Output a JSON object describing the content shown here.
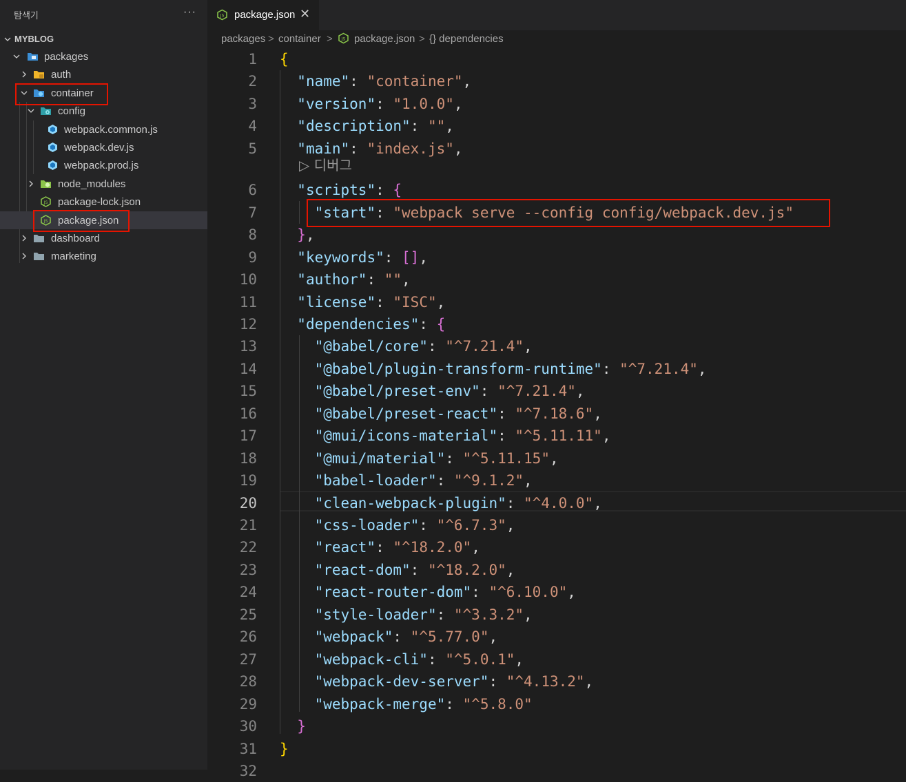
{
  "sidebar": {
    "title": "탐색기",
    "more_label": "···",
    "root_label": "MYBLOG",
    "items": [
      {
        "label": "packages"
      },
      {
        "label": "auth"
      },
      {
        "label": "container"
      },
      {
        "label": "config"
      },
      {
        "label": "webpack.common.js"
      },
      {
        "label": "webpack.dev.js"
      },
      {
        "label": "webpack.prod.js"
      },
      {
        "label": "node_modules"
      },
      {
        "label": "package-lock.json"
      },
      {
        "label": "package.json"
      },
      {
        "label": "dashboard"
      },
      {
        "label": "marketing"
      }
    ]
  },
  "tab": {
    "label": "package.json",
    "close_label": "✕"
  },
  "breadcrumb": {
    "items": [
      "packages",
      "container",
      "package.json",
      "{} dependencies"
    ],
    "separator": ">"
  },
  "editor": {
    "codelens_label": "▷ 디버그",
    "current_line": 20,
    "line_numbers": [
      "1",
      "2",
      "3",
      "4",
      "5",
      "6",
      "7",
      "8",
      "9",
      "10",
      "11",
      "12",
      "13",
      "14",
      "15",
      "16",
      "17",
      "18",
      "19",
      "20",
      "21",
      "22",
      "23",
      "24",
      "25",
      "26",
      "27",
      "28",
      "29",
      "30",
      "31",
      "32"
    ],
    "lines": [
      {
        "indent": "",
        "key": "",
        "value": "",
        "open": "{",
        "close": "",
        "tail": ""
      },
      {
        "indent": "  ",
        "key": "\"name\"",
        "sep": ": ",
        "value": "\"container\"",
        "tail": ","
      },
      {
        "indent": "  ",
        "key": "\"version\"",
        "sep": ": ",
        "value": "\"1.0.0\"",
        "tail": ","
      },
      {
        "indent": "  ",
        "key": "\"description\"",
        "sep": ": ",
        "value": "\"\"",
        "tail": ","
      },
      {
        "indent": "  ",
        "key": "\"main\"",
        "sep": ": ",
        "value": "\"index.js\"",
        "tail": ","
      },
      {
        "indent": "  ",
        "key": "\"scripts\"",
        "sep": ": ",
        "value": "",
        "open": "{",
        "tail": ""
      },
      {
        "indent": "    ",
        "key": "\"start\"",
        "sep": ": ",
        "value": "\"webpack serve --config config/webpack.dev.js\"",
        "tail": ""
      },
      {
        "indent": "  ",
        "key": "",
        "sep": "",
        "value": "",
        "close": "}",
        "tail": ","
      },
      {
        "indent": "  ",
        "key": "\"keywords\"",
        "sep": ": ",
        "value": "",
        "open": "[]",
        "tail": ","
      },
      {
        "indent": "  ",
        "key": "\"author\"",
        "sep": ": ",
        "value": "\"\"",
        "tail": ","
      },
      {
        "indent": "  ",
        "key": "\"license\"",
        "sep": ": ",
        "value": "\"ISC\"",
        "tail": ","
      },
      {
        "indent": "  ",
        "key": "\"dependencies\"",
        "sep": ": ",
        "value": "",
        "open": "{",
        "tail": ""
      },
      {
        "indent": "    ",
        "key": "\"@babel/core\"",
        "sep": ": ",
        "value": "\"^7.21.4\"",
        "tail": ","
      },
      {
        "indent": "    ",
        "key": "\"@babel/plugin-transform-runtime\"",
        "sep": ": ",
        "value": "\"^7.21.4\"",
        "tail": ","
      },
      {
        "indent": "    ",
        "key": "\"@babel/preset-env\"",
        "sep": ": ",
        "value": "\"^7.21.4\"",
        "tail": ","
      },
      {
        "indent": "    ",
        "key": "\"@babel/preset-react\"",
        "sep": ": ",
        "value": "\"^7.18.6\"",
        "tail": ","
      },
      {
        "indent": "    ",
        "key": "\"@mui/icons-material\"",
        "sep": ": ",
        "value": "\"^5.11.11\"",
        "tail": ","
      },
      {
        "indent": "    ",
        "key": "\"@mui/material\"",
        "sep": ": ",
        "value": "\"^5.11.15\"",
        "tail": ","
      },
      {
        "indent": "    ",
        "key": "\"babel-loader\"",
        "sep": ": ",
        "value": "\"^9.1.2\"",
        "tail": ","
      },
      {
        "indent": "    ",
        "key": "\"clean-webpack-plugin\"",
        "sep": ": ",
        "value": "\"^4.0.0\"",
        "tail": ","
      },
      {
        "indent": "    ",
        "key": "\"css-loader\"",
        "sep": ": ",
        "value": "\"^6.7.3\"",
        "tail": ","
      },
      {
        "indent": "    ",
        "key": "\"react\"",
        "sep": ": ",
        "value": "\"^18.2.0\"",
        "tail": ","
      },
      {
        "indent": "    ",
        "key": "\"react-dom\"",
        "sep": ": ",
        "value": "\"^18.2.0\"",
        "tail": ","
      },
      {
        "indent": "    ",
        "key": "\"react-router-dom\"",
        "sep": ": ",
        "value": "\"^6.10.0\"",
        "tail": ","
      },
      {
        "indent": "    ",
        "key": "\"style-loader\"",
        "sep": ": ",
        "value": "\"^3.3.2\"",
        "tail": ","
      },
      {
        "indent": "    ",
        "key": "\"webpack\"",
        "sep": ": ",
        "value": "\"^5.77.0\"",
        "tail": ","
      },
      {
        "indent": "    ",
        "key": "\"webpack-cli\"",
        "sep": ": ",
        "value": "\"^5.0.1\"",
        "tail": ","
      },
      {
        "indent": "    ",
        "key": "\"webpack-dev-server\"",
        "sep": ": ",
        "value": "\"^4.13.2\"",
        "tail": ","
      },
      {
        "indent": "    ",
        "key": "\"webpack-merge\"",
        "sep": ": ",
        "value": "\"^5.8.0\"",
        "tail": ""
      },
      {
        "indent": "  ",
        "key": "",
        "sep": "",
        "value": "",
        "close": "}",
        "tail": ""
      },
      {
        "indent": "",
        "key": "",
        "sep": "",
        "value": "",
        "close": "}",
        "tail": ""
      },
      {
        "indent": "",
        "key": "",
        "sep": "",
        "value": "",
        "tail": ""
      }
    ]
  },
  "colors": {
    "highlight_box": "#e51400",
    "json_key": "#9cdcfe",
    "json_string": "#ce9178",
    "bracket_level1": "#ffd700",
    "bracket_level2": "#da70d6"
  }
}
